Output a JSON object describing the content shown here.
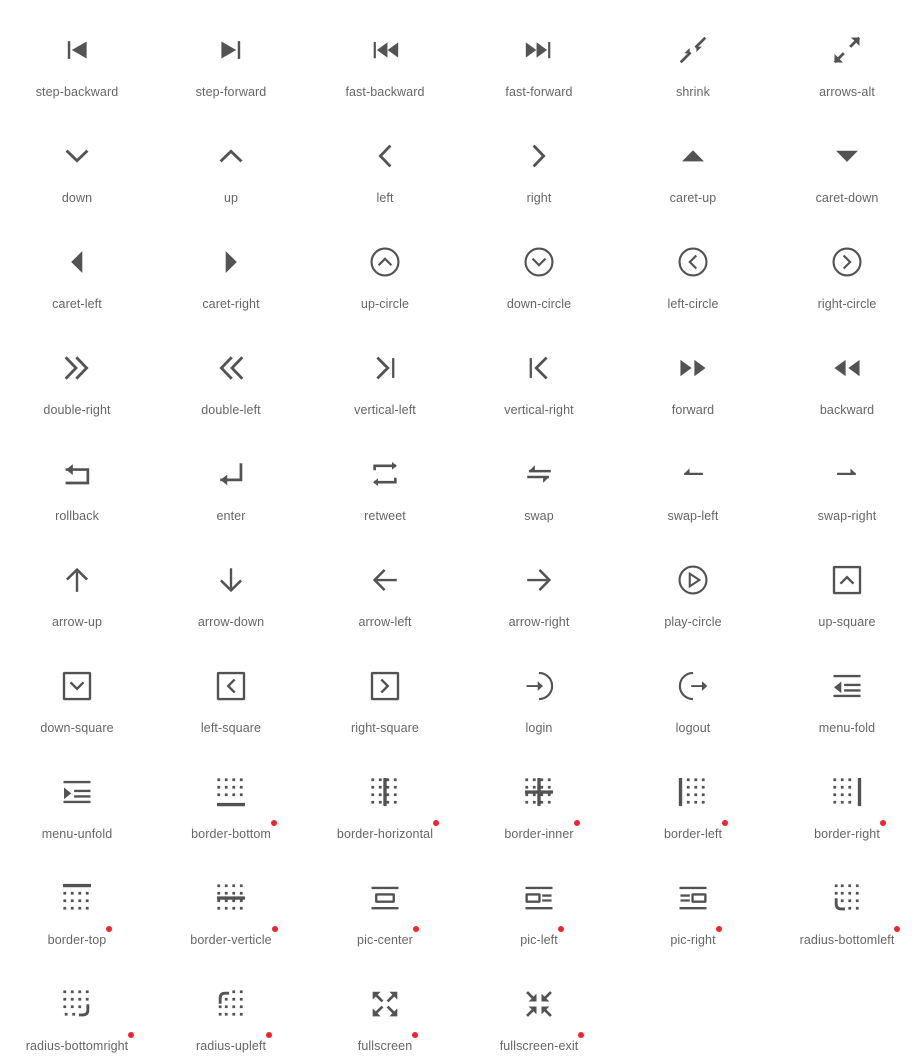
{
  "gallery": {
    "columns": 6,
    "icon_color": "#535353",
    "label_color": "#666666",
    "badge_color": "#f5222d",
    "background": "#ffffff",
    "icons": [
      {
        "label": "step-backward",
        "icon": "step-backward-icon",
        "badge": false
      },
      {
        "label": "step-forward",
        "icon": "step-forward-icon",
        "badge": false
      },
      {
        "label": "fast-backward",
        "icon": "fast-backward-icon",
        "badge": false
      },
      {
        "label": "fast-forward",
        "icon": "fast-forward-icon",
        "badge": false
      },
      {
        "label": "shrink",
        "icon": "shrink-icon",
        "badge": false
      },
      {
        "label": "arrows-alt",
        "icon": "arrows-alt-icon",
        "badge": false
      },
      {
        "label": "down",
        "icon": "down-icon",
        "badge": false
      },
      {
        "label": "up",
        "icon": "up-icon",
        "badge": false
      },
      {
        "label": "left",
        "icon": "left-icon",
        "badge": false
      },
      {
        "label": "right",
        "icon": "right-icon",
        "badge": false
      },
      {
        "label": "caret-up",
        "icon": "caret-up-icon",
        "badge": false
      },
      {
        "label": "caret-down",
        "icon": "caret-down-icon",
        "badge": false
      },
      {
        "label": "caret-left",
        "icon": "caret-left-icon",
        "badge": false
      },
      {
        "label": "caret-right",
        "icon": "caret-right-icon",
        "badge": false
      },
      {
        "label": "up-circle",
        "icon": "up-circle-icon",
        "badge": false
      },
      {
        "label": "down-circle",
        "icon": "down-circle-icon",
        "badge": false
      },
      {
        "label": "left-circle",
        "icon": "left-circle-icon",
        "badge": false
      },
      {
        "label": "right-circle",
        "icon": "right-circle-icon",
        "badge": false
      },
      {
        "label": "double-right",
        "icon": "double-right-icon",
        "badge": false
      },
      {
        "label": "double-left",
        "icon": "double-left-icon",
        "badge": false
      },
      {
        "label": "vertical-left",
        "icon": "vertical-left-icon",
        "badge": false
      },
      {
        "label": "vertical-right",
        "icon": "vertical-right-icon",
        "badge": false
      },
      {
        "label": "forward",
        "icon": "forward-icon",
        "badge": false
      },
      {
        "label": "backward",
        "icon": "backward-icon",
        "badge": false
      },
      {
        "label": "rollback",
        "icon": "rollback-icon",
        "badge": false
      },
      {
        "label": "enter",
        "icon": "enter-icon",
        "badge": false
      },
      {
        "label": "retweet",
        "icon": "retweet-icon",
        "badge": false
      },
      {
        "label": "swap",
        "icon": "swap-icon",
        "badge": false
      },
      {
        "label": "swap-left",
        "icon": "swap-left-icon",
        "badge": false
      },
      {
        "label": "swap-right",
        "icon": "swap-right-icon",
        "badge": false
      },
      {
        "label": "arrow-up",
        "icon": "arrow-up-icon",
        "badge": false
      },
      {
        "label": "arrow-down",
        "icon": "arrow-down-icon",
        "badge": false
      },
      {
        "label": "arrow-left",
        "icon": "arrow-left-icon",
        "badge": false
      },
      {
        "label": "arrow-right",
        "icon": "arrow-right-icon",
        "badge": false
      },
      {
        "label": "play-circle",
        "icon": "play-circle-icon",
        "badge": false
      },
      {
        "label": "up-square",
        "icon": "up-square-icon",
        "badge": false
      },
      {
        "label": "down-square",
        "icon": "down-square-icon",
        "badge": false
      },
      {
        "label": "left-square",
        "icon": "left-square-icon",
        "badge": false
      },
      {
        "label": "right-square",
        "icon": "right-square-icon",
        "badge": false
      },
      {
        "label": "login",
        "icon": "login-icon",
        "badge": false
      },
      {
        "label": "logout",
        "icon": "logout-icon",
        "badge": false
      },
      {
        "label": "menu-fold",
        "icon": "menu-fold-icon",
        "badge": false
      },
      {
        "label": "menu-unfold",
        "icon": "menu-unfold-icon",
        "badge": false
      },
      {
        "label": "border-bottom",
        "icon": "border-bottom-icon",
        "badge": true
      },
      {
        "label": "border-horizontal",
        "icon": "border-horizontal-icon",
        "badge": true
      },
      {
        "label": "border-inner",
        "icon": "border-inner-icon",
        "badge": true
      },
      {
        "label": "border-left",
        "icon": "border-left-icon",
        "badge": true
      },
      {
        "label": "border-right",
        "icon": "border-right-icon",
        "badge": true
      },
      {
        "label": "border-top",
        "icon": "border-top-icon",
        "badge": true
      },
      {
        "label": "border-verticle",
        "icon": "border-verticle-icon",
        "badge": true
      },
      {
        "label": "pic-center",
        "icon": "pic-center-icon",
        "badge": true
      },
      {
        "label": "pic-left",
        "icon": "pic-left-icon",
        "badge": true
      },
      {
        "label": "pic-right",
        "icon": "pic-right-icon",
        "badge": true
      },
      {
        "label": "radius-bottomleft",
        "icon": "radius-bottomleft-icon",
        "badge": true
      },
      {
        "label": "radius-bottomright",
        "icon": "radius-bottomright-icon",
        "badge": true
      },
      {
        "label": "radius-upleft",
        "icon": "radius-upleft-icon",
        "badge": true
      },
      {
        "label": "fullscreen",
        "icon": "fullscreen-icon",
        "badge": true
      },
      {
        "label": "fullscreen-exit",
        "icon": "fullscreen-exit-icon",
        "badge": true
      }
    ]
  }
}
